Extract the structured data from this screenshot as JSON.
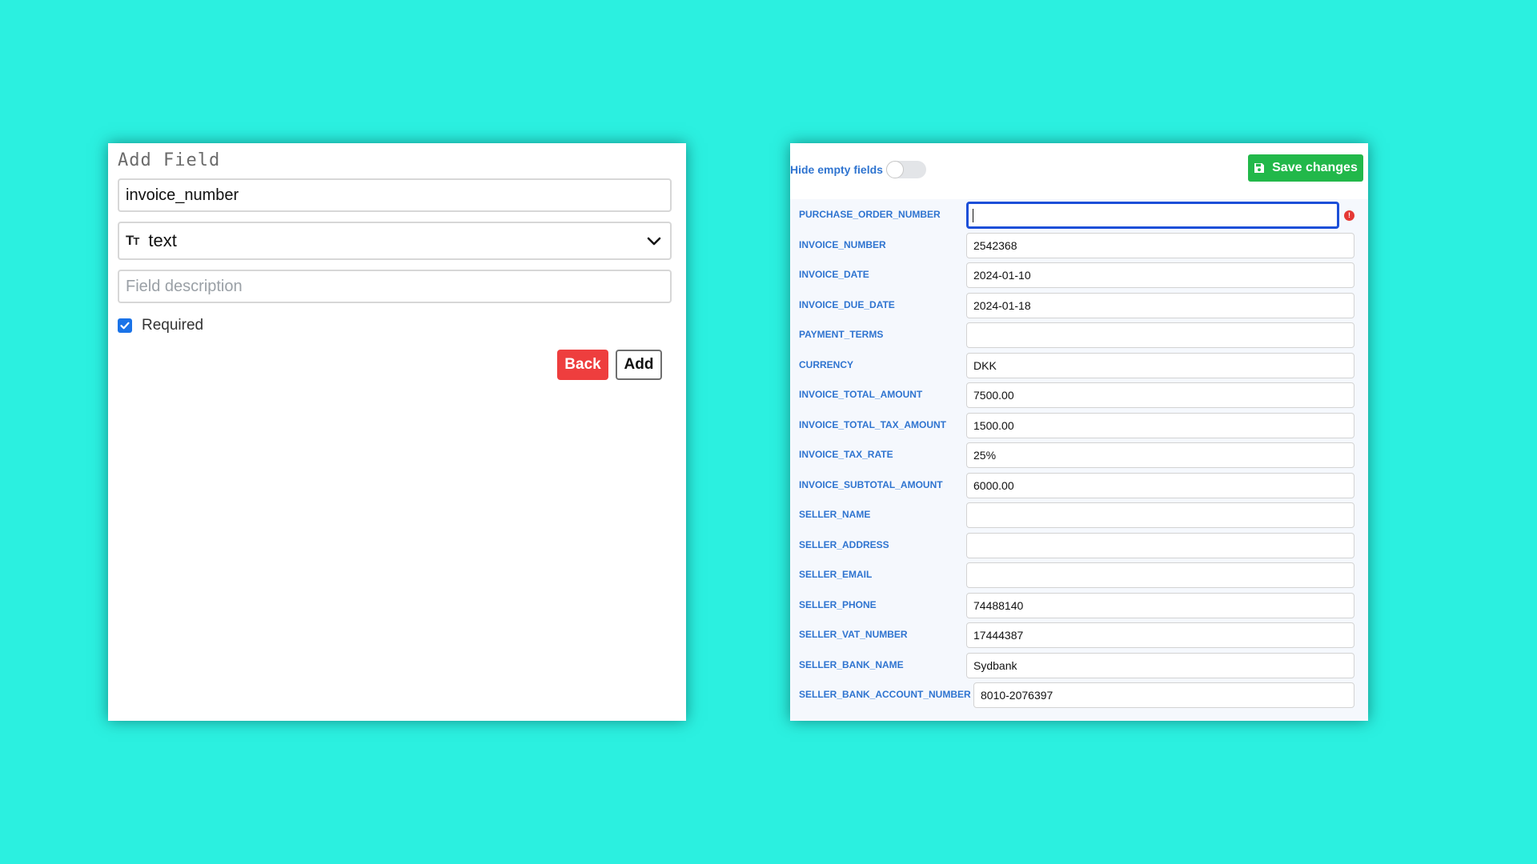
{
  "add_field": {
    "title": "Add Field",
    "name_value": "invoice_number",
    "type_icon": "text-type-icon",
    "type_value": "text",
    "description_placeholder": "Field description",
    "required_label": "Required",
    "required_checked": true,
    "back_label": "Back",
    "add_label": "Add"
  },
  "fields_panel": {
    "hide_empty_label": "Hide empty fields",
    "hide_empty_enabled": false,
    "save_label": "Save changes",
    "rows": [
      {
        "label": "PURCHASE_ORDER_NUMBER",
        "value": "",
        "active": true,
        "error": true
      },
      {
        "label": "INVOICE_NUMBER",
        "value": "2542368"
      },
      {
        "label": "INVOICE_DATE",
        "value": "2024-01-10"
      },
      {
        "label": "INVOICE_DUE_DATE",
        "value": "2024-01-18"
      },
      {
        "label": "PAYMENT_TERMS",
        "value": ""
      },
      {
        "label": "CURRENCY",
        "value": "DKK"
      },
      {
        "label": "INVOICE_TOTAL_AMOUNT",
        "value": "7500.00"
      },
      {
        "label": "INVOICE_TOTAL_TAX_AMOUNT",
        "value": "1500.00"
      },
      {
        "label": "INVOICE_TAX_RATE",
        "value": "25%"
      },
      {
        "label": "INVOICE_SUBTOTAL_AMOUNT",
        "value": "6000.00"
      },
      {
        "label": "SELLER_NAME",
        "value": ""
      },
      {
        "label": "SELLER_ADDRESS",
        "value": ""
      },
      {
        "label": "SELLER_EMAIL",
        "value": ""
      },
      {
        "label": "SELLER_PHONE",
        "value": "74488140"
      },
      {
        "label": "SELLER_VAT_NUMBER",
        "value": "17444387"
      },
      {
        "label": "SELLER_BANK_NAME",
        "value": "Sydbank"
      },
      {
        "label": "SELLER_BANK_ACCOUNT_NUMBER",
        "value": "8010-2076397"
      }
    ]
  },
  "colors": {
    "background": "#2bf0e0",
    "label_blue": "#2f74d0",
    "back_red": "#ee3e3e",
    "save_green": "#22b84a",
    "focus_blue": "#1c4fd8",
    "error_red": "#e53935"
  }
}
